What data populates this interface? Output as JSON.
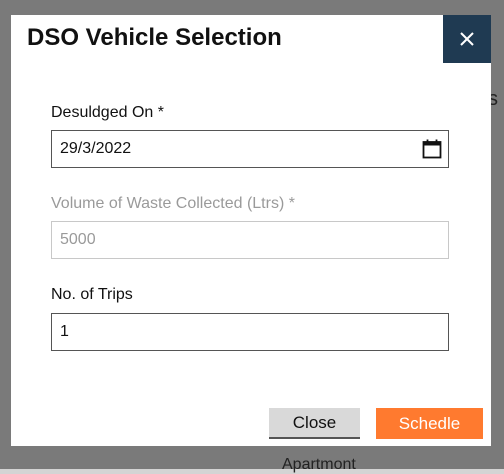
{
  "modal": {
    "title": "DSO Vehicle Selection",
    "close_icon": "close-icon"
  },
  "fields": {
    "desludged_on": {
      "label": "Desuldged On *",
      "value": "29/3/2022",
      "icon": "calendar-icon"
    },
    "volume": {
      "label": "Volume of Waste Collected (Ltrs) *",
      "value": "5000",
      "disabled": true
    },
    "trips": {
      "label": "No. of Trips",
      "value": "1"
    }
  },
  "buttons": {
    "close_label": "Close",
    "schedule_label": "Schedle"
  },
  "background": {
    "fragment_text": "Apartmont"
  },
  "colors": {
    "close_x_bg": "#1f3a52",
    "schedule_bg": "#ff7a2f",
    "close_bg": "#d9d9d9"
  }
}
